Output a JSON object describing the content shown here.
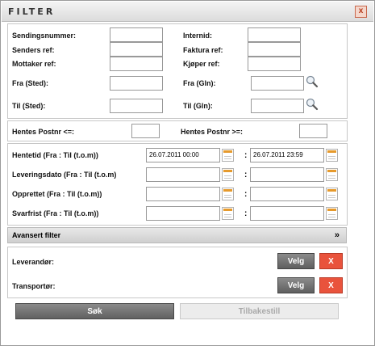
{
  "dialog": {
    "title": "FILTER",
    "close_label": "x"
  },
  "ids": {
    "sendingsnummer": "Sendingsnummer:",
    "internid": "Internid:",
    "senders_ref": "Senders ref:",
    "faktura_ref": "Faktura ref:",
    "mottaker_ref": "Mottaker ref:",
    "kjoper_ref": "Kjøper ref:",
    "fra_sted": "Fra (Sted):",
    "fra_gln": "Fra (Gln):",
    "til_sted": "Til (Sted):",
    "til_gln": "Til (Gln):"
  },
  "postnr": {
    "from_label": "Hentes Postnr <=:",
    "to_label": "Hentes Postnr >=:"
  },
  "dates": {
    "colon": ":",
    "rows": [
      {
        "label": "Hentetid (Fra : Til (t.o.m))",
        "from": "26.07.2011 00:00",
        "to": "26.07.2011 23:59"
      },
      {
        "label": "Leveringsdato (Fra : Til (t.o.m)",
        "from": "",
        "to": ""
      },
      {
        "label": "Opprettet (Fra : Til (t.o.m))",
        "from": "",
        "to": ""
      },
      {
        "label": "Svarfrist (Fra : Til (t.o.m))",
        "from": "",
        "to": ""
      }
    ]
  },
  "advanced": {
    "label": "Avansert filter",
    "chevron": "»"
  },
  "pickers": {
    "leverandor": "Leverandør:",
    "transportor": "Transportør:",
    "velg_label": "Velg",
    "clear_label": "X"
  },
  "actions": {
    "search_label": "Søk",
    "reset_label": "Tilbakestill"
  },
  "colors": {
    "clear_button": "#e9533c",
    "calendar_accent": "#e69a2c"
  },
  "icons": [
    "close-icon",
    "magnifier-icon",
    "calendar-icon",
    "double-chevron-icon"
  ]
}
